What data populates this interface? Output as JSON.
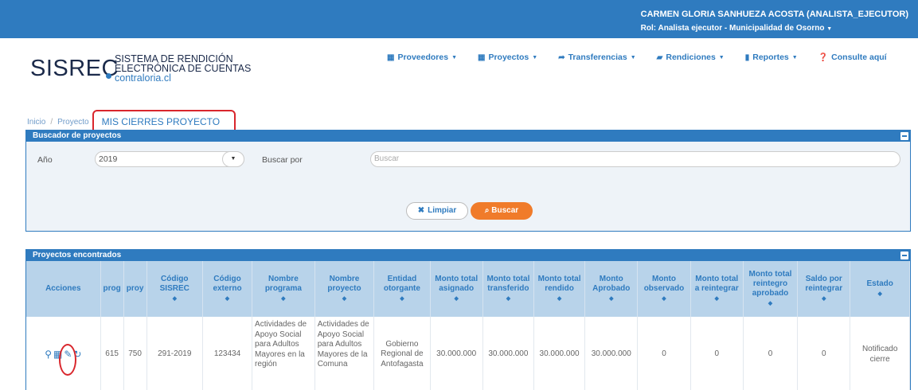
{
  "header": {
    "user_name": "CARMEN GLORIA SANHUEZA ACOSTA (ANALISTA_EJECUTOR)",
    "user_role": "Rol: Analista ejecutor - Municipalidad de Osorno",
    "accent_color": "#2f7bbf"
  },
  "logo": {
    "main": "SISREC",
    "line1": "SISTEMA DE RENDICIÓN",
    "line2": "ELECTRÓNICA DE CUENTAS",
    "domain": "contraloria.cl"
  },
  "nav": [
    {
      "label": "Proveedores",
      "icon": "calendar-icon",
      "dropdown": true
    },
    {
      "label": "Proyectos",
      "icon": "calendar-icon",
      "dropdown": true
    },
    {
      "label": "Transferencias",
      "icon": "share-arrow-icon",
      "dropdown": true
    },
    {
      "label": "Rendiciones",
      "icon": "book-icon",
      "dropdown": true
    },
    {
      "label": "Reportes",
      "icon": "bar-chart-icon",
      "dropdown": true
    },
    {
      "label": "Consulte aquí",
      "icon": "question-circle-icon",
      "dropdown": false
    }
  ],
  "breadcrumb": {
    "home": "Inicio",
    "section": "Proyecto",
    "current": "MIS CIERRES PROYECTO"
  },
  "search_panel": {
    "title": "Buscador de proyectos",
    "year_label": "Año",
    "year_value": "2019",
    "search_by_label": "Buscar por",
    "search_placeholder": "Buscar",
    "clear_label": "Limpiar",
    "search_label": "Buscar",
    "search_button_color": "#f07b2a"
  },
  "results_panel": {
    "title": "Proyectos encontrados",
    "columns": [
      "Acciones",
      "prog",
      "proy",
      "Código SISREC",
      "Código externo",
      "Nombre programa",
      "Nombre proyecto",
      "Entidad otorgante",
      "Monto total asignado",
      "Monto total transferido",
      "Monto total rendido",
      "Monto Aprobado",
      "Monto observado",
      "Monto total a reintegrar",
      "Monto total reintegro aprobado",
      "Saldo por reintegrar",
      "Estado"
    ],
    "rows": [
      {
        "prog": "615",
        "proy": "750",
        "codigo_sisrec": "291-2019",
        "codigo_externo": "123434",
        "nombre_programa": "Actividades de Apoyo Social para Adultos Mayores en la región",
        "nombre_proyecto": "Actividades de Apoyo Social para Adultos Mayores de la Comuna",
        "entidad": "Gobierno Regional de Antofagasta",
        "asignado": "30.000.000",
        "transferido": "30.000.000",
        "rendido": "30.000.000",
        "aprobado": "30.000.000",
        "observado": "0",
        "a_reintegrar": "0",
        "reintegro_aprobado": "0",
        "saldo": "0",
        "estado": "Notificado cierre"
      }
    ]
  }
}
